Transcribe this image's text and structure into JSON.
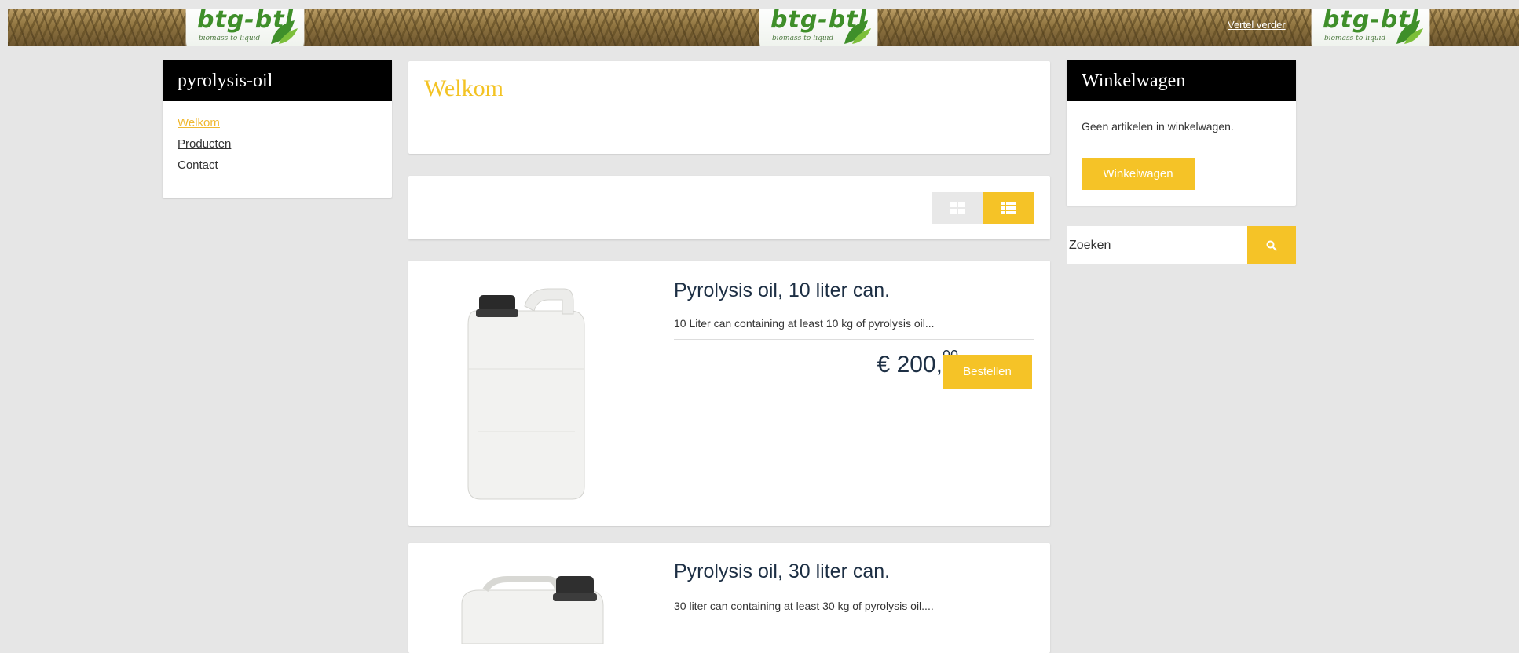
{
  "banner": {
    "logo_text": "btg-btl",
    "logo_sub": "biomass-to-liquid",
    "read_more": "Vertel verder"
  },
  "sidebar": {
    "title": "pyrolysis-oil",
    "items": [
      {
        "label": "Welkom",
        "active": true
      },
      {
        "label": "Producten",
        "active": false
      },
      {
        "label": "Contact",
        "active": false
      }
    ]
  },
  "main": {
    "title": "Welkom",
    "view_modes": [
      "grid",
      "list"
    ],
    "active_view": "list",
    "products": [
      {
        "name": "Pyrolysis oil, 10 liter can.",
        "description": "10 Liter can containing at least 10 kg of pyrolysis oil...",
        "price_main": "€ 200,",
        "price_cents": "00",
        "order_label": "Bestellen"
      },
      {
        "name": "Pyrolysis oil, 30 liter can.",
        "description": "30 liter can containing at least 30 kg of pyrolysis oil...."
      }
    ]
  },
  "cart": {
    "title": "Winkelwagen",
    "empty_text": "Geen artikelen in winkelwagen.",
    "button_label": "Winkelwagen"
  },
  "search": {
    "placeholder": "Zoeken"
  },
  "colors": {
    "accent": "#f5c327",
    "heading": "#1d2f44",
    "page_bg": "#e6e6e6"
  }
}
